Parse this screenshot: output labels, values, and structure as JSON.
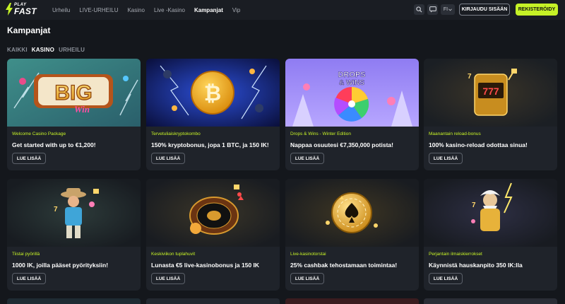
{
  "brand": {
    "logo_top": "PLAY",
    "logo_bottom": "FAST",
    "accent": "#c6f227"
  },
  "nav": {
    "items": [
      {
        "label": "Urheilu",
        "active": false
      },
      {
        "label": "LIVE-URHEILU",
        "active": false
      },
      {
        "label": "Kasino",
        "active": false
      },
      {
        "label": "Live -Kasino",
        "active": false
      },
      {
        "label": "Kampanjat",
        "active": true
      },
      {
        "label": "Vip",
        "active": false
      }
    ]
  },
  "header_actions": {
    "search_icon": "search-icon",
    "chat_icon": "chat-icon",
    "language": "FI",
    "login_label": "KIRJAUDU SISÄÄN",
    "register_label": "REKISTERÖIDY"
  },
  "page": {
    "title": "Kampanjat"
  },
  "filters": [
    {
      "label": "KAIKKI",
      "active": false
    },
    {
      "label": "KASINO",
      "active": true
    },
    {
      "label": "URHEILU",
      "active": false
    }
  ],
  "promotions": [
    {
      "tag": "Welcome Casino Package",
      "title": "Get started with up to €1,200!",
      "button": "LUE LISÄÄ"
    },
    {
      "tag": "Tervetuliaiskryptokombo",
      "title": "150% kryptobonus, jopa 1 BTC, ja 150 IK!",
      "button": "LUE LISÄÄ"
    },
    {
      "tag": "Drops & Wins - Winter Edition",
      "title": "Nappaa osuutesi €7,350,000 potista!",
      "button": "LUE LISÄÄ"
    },
    {
      "tag": "Maanantain reload-bonus",
      "title": "100% kasino-reload odottaa sinua!",
      "button": "LUE LISÄÄ"
    },
    {
      "tag": "Tiistai pyörillä",
      "title": "1000 IK, joilla pääset pyörityksiin!",
      "button": "LUE LISÄÄ"
    },
    {
      "tag": "Keskiviikon tuplahuvit",
      "title": "Lunasta €5 live-kasinobonus ja 150 IK",
      "button": "LUE LISÄÄ"
    },
    {
      "tag": "Live-kasinotorstai",
      "title": "25% cashbak tehostamaan toimintaa!",
      "button": "LUE LISÄÄ"
    },
    {
      "tag": "Perjantain ilmaiskierrokset",
      "title": "Käynnistä hauskanpito 350 IK:lla",
      "button": "LUE LISÄÄ"
    }
  ],
  "card_art": {
    "big_win": {
      "word": "BIG",
      "sub": "Win"
    },
    "drops_wins": {
      "line1": "DROPS",
      "amp": "&",
      "line2": "WINS"
    }
  }
}
